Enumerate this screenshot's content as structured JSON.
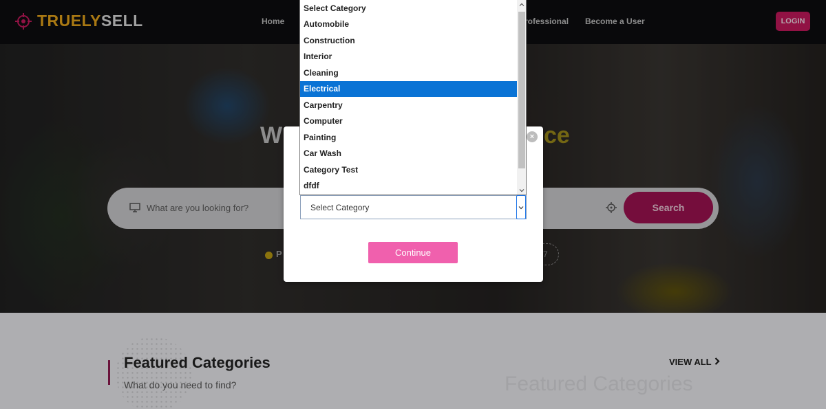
{
  "header": {
    "logo_part1": "TRUELY",
    "logo_part2": "SELL",
    "nav": [
      "Home",
      "Professional",
      "Become a User"
    ],
    "login_label": "LOGIN"
  },
  "hero": {
    "title_fragment_left": "W",
    "title_fragment_right": "ce",
    "search_placeholder": "What are you looking for?",
    "search_button": "Search",
    "popular_fragment": "P",
    "chip_fragment": "7"
  },
  "featured": {
    "title": "Featured Categories",
    "subtitle": "What do you need to find?",
    "ghost_title": "Featured Categories",
    "view_all": "VIEW ALL"
  },
  "modal": {
    "close_symbol": "×",
    "select_value": "Select Category",
    "continue_label": "Continue"
  },
  "dropdown": {
    "options": [
      "Select Category",
      "Automobile",
      "Construction",
      "Interior",
      "Cleaning",
      "Electrical",
      "Carpentry",
      "Computer",
      "Painting",
      "Car Wash",
      "Category Test",
      "dfdf"
    ],
    "selected": "Electrical"
  },
  "colors": {
    "brand_pink": "#c2185b",
    "brand_gold": "#e3a21a",
    "continue_pink": "#f060ad",
    "selection_blue": "#0a73d5"
  },
  "icons": [
    "crosshair-logo-icon",
    "monitor-icon",
    "target-location-icon",
    "chevron-right-icon",
    "chevron-down-icon",
    "close-icon",
    "scroll-up-icon",
    "scroll-down-icon"
  ]
}
